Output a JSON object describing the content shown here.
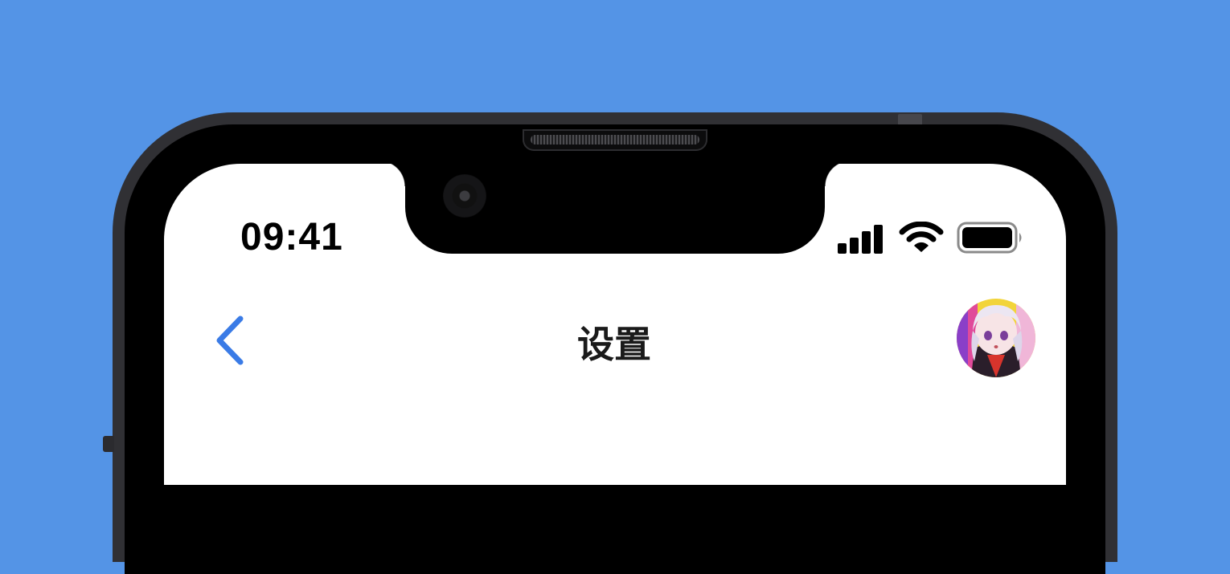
{
  "status_bar": {
    "time": "09:41",
    "icons": [
      "cellular-signal-icon",
      "wifi-icon",
      "battery-icon"
    ]
  },
  "nav": {
    "back_icon": "chevron-left-icon",
    "title": "设置",
    "avatar_icon": "user-avatar"
  },
  "colors": {
    "background": "#5494e6",
    "accent": "#3a7be6",
    "title_text": "#1a1a1a"
  }
}
